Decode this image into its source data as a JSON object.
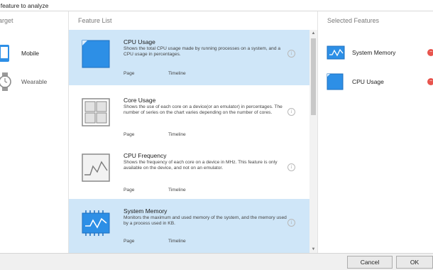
{
  "window": {
    "title": "t feature to analyze"
  },
  "columns": {
    "target": "arget",
    "feature_list": "Feature List",
    "selected": "Selected Features"
  },
  "targets": [
    {
      "label": "Mobile",
      "icon": "mobile-icon"
    },
    {
      "label": "Wearable",
      "icon": "watch-icon"
    }
  ],
  "features": [
    {
      "name": "CPU Usage",
      "description": "Shows the total CPU usage made by running processes on a system, and a CPU usage in percentages.",
      "tag1": "Page",
      "tag2": "Timeline",
      "selected": true,
      "icon": "cpu-usage-icon"
    },
    {
      "name": "Core Usage",
      "description": "Shows the use of each core on a device(or an emulator) in percentages. The number of series on the chart varies depending on the number of cores.",
      "tag1": "Page",
      "tag2": "Timeline",
      "selected": false,
      "icon": "core-usage-icon"
    },
    {
      "name": "CPU Frequency",
      "description": "Shows the frequency of each core on a device in MHz. This feature is only available on the device, and not on an emulator.",
      "tag1": "Page",
      "tag2": "Timeline",
      "selected": false,
      "icon": "cpu-frequency-icon"
    },
    {
      "name": "System Memory",
      "description": "Monitors the maximum and used memory of the system, and the memory used by a process used in KB.",
      "tag1": "Page",
      "tag2": "Timeline",
      "selected": true,
      "icon": "system-memory-icon"
    }
  ],
  "selected_features": [
    {
      "label": "System Memory",
      "icon": "system-memory-icon"
    },
    {
      "label": "CPU Usage",
      "icon": "cpu-usage-icon"
    }
  ],
  "buttons": {
    "cancel": "Cancel",
    "ok": "OK"
  },
  "colors": {
    "accent": "#2d8fe6",
    "selected_row": "#cfe6f8",
    "remove": "#e8544d"
  },
  "info_glyph": "i",
  "remove_glyph": "−"
}
